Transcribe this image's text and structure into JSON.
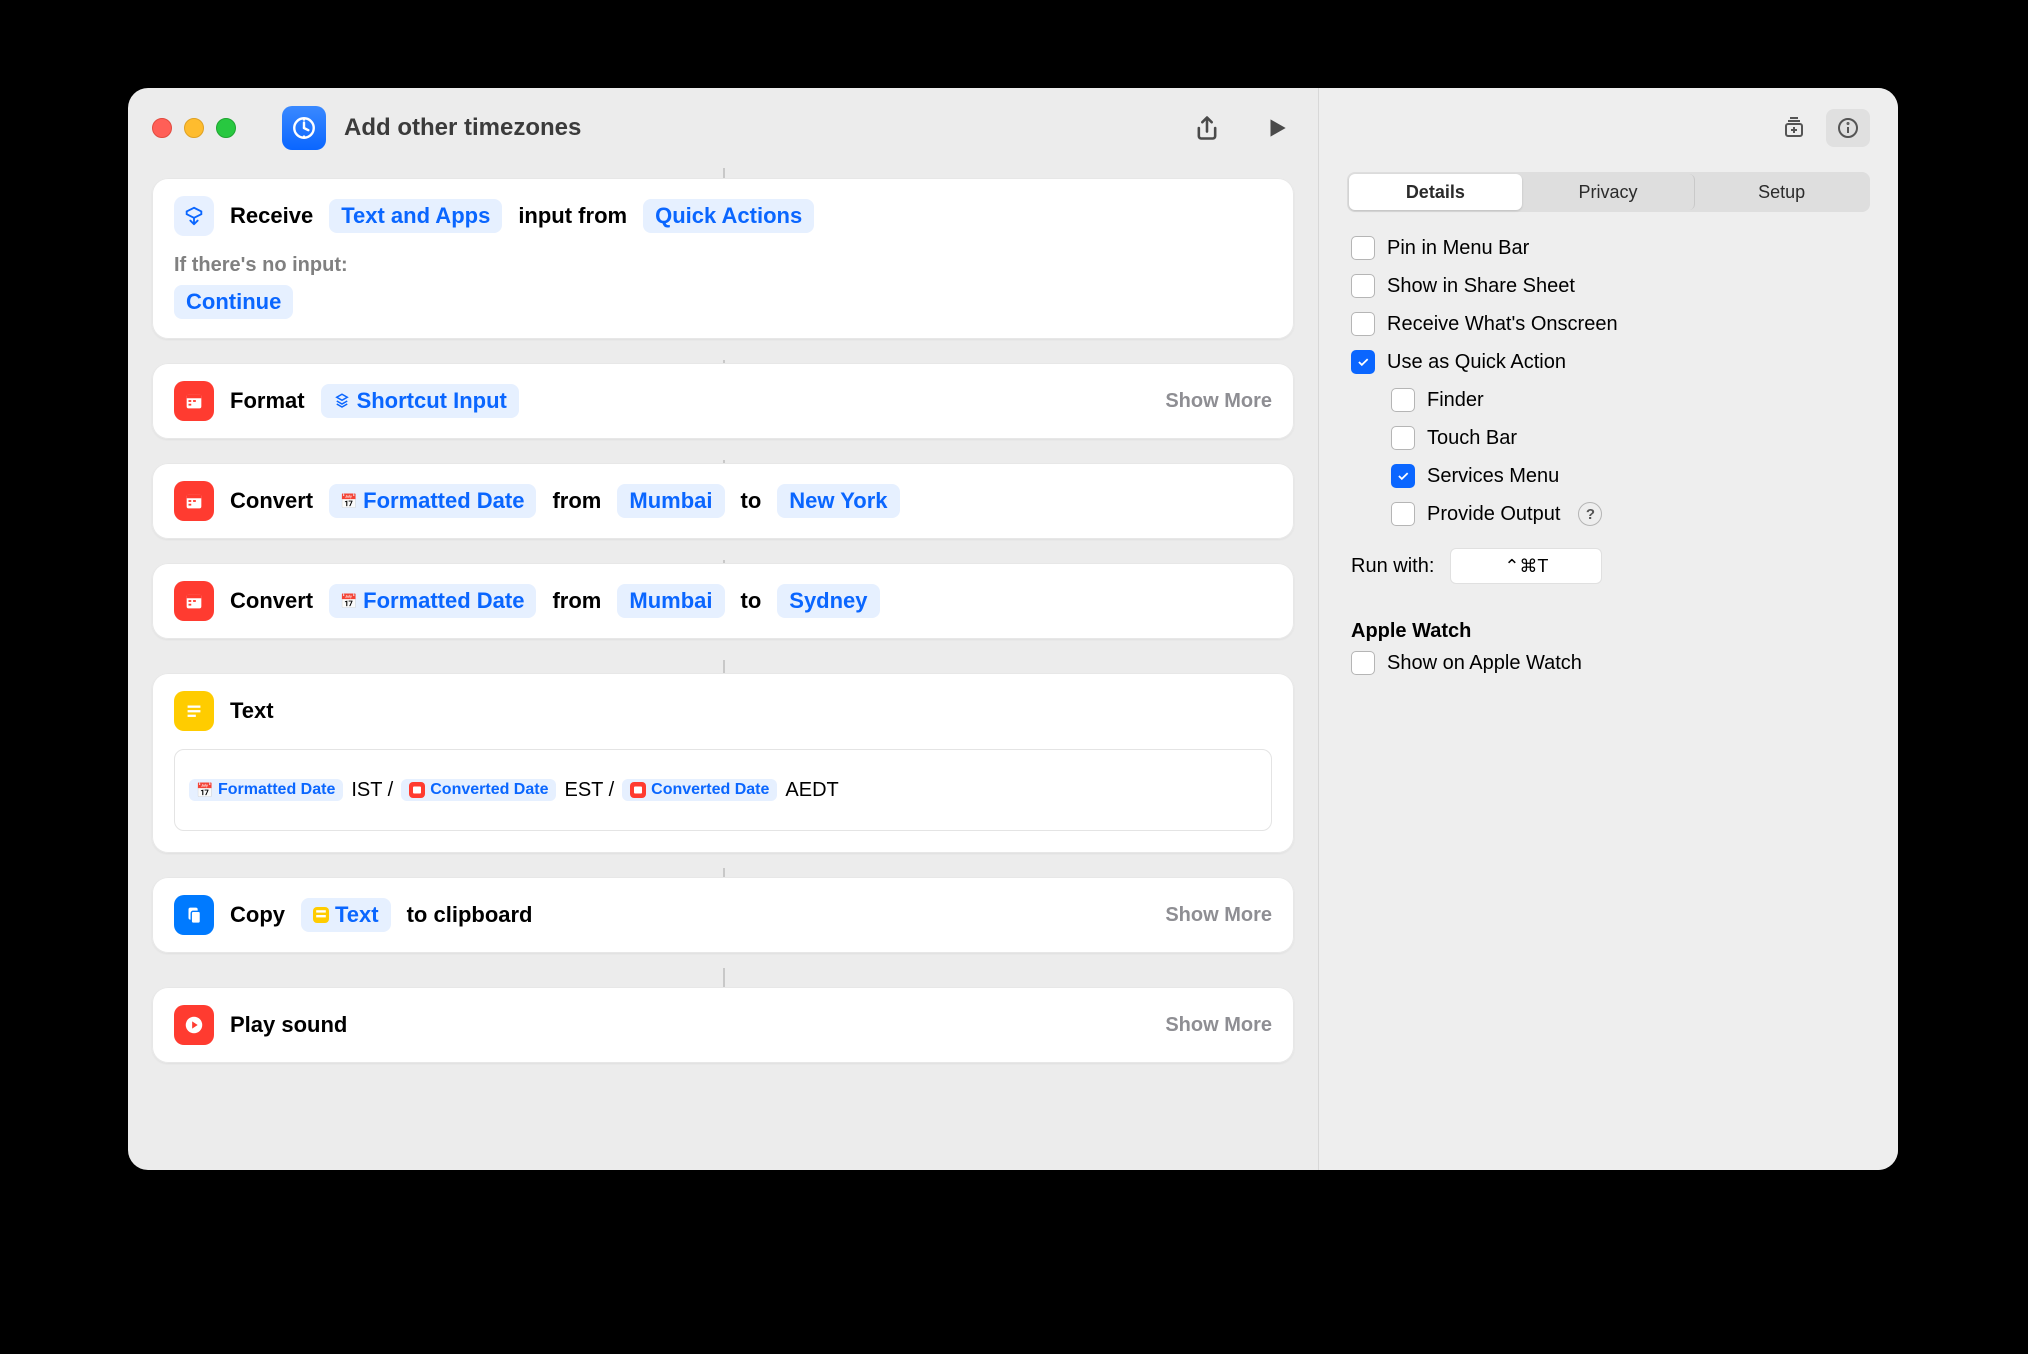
{
  "header": {
    "title": "Add other timezones"
  },
  "actions": {
    "receive": {
      "verb": "Receive",
      "token_types": "Text and Apps",
      "mid": "input from",
      "token_source": "Quick Actions",
      "noinput_label": "If there's no input:",
      "noinput_value": "Continue"
    },
    "format": {
      "verb": "Format",
      "token": "Shortcut Input",
      "show_more": "Show More"
    },
    "convert1": {
      "verb": "Convert",
      "token": "Formatted Date",
      "from": "from",
      "city_from": "Mumbai",
      "to": "to",
      "city_to": "New York"
    },
    "convert2": {
      "verb": "Convert",
      "token": "Formatted Date",
      "from": "from",
      "city_from": "Mumbai",
      "to": "to",
      "city_to": "Sydney"
    },
    "text": {
      "verb": "Text",
      "tok1": "Formatted Date",
      "t1": "IST /",
      "tok2": "Converted Date",
      "t2": "EST /",
      "tok3": "Converted Date",
      "t3": "AEDT"
    },
    "copy": {
      "verb": "Copy",
      "token": "Text",
      "suffix": "to clipboard",
      "show_more": "Show More"
    },
    "play": {
      "verb": "Play sound",
      "show_more": "Show More"
    }
  },
  "inspector": {
    "tabs": {
      "details": "Details",
      "privacy": "Privacy",
      "setup": "Setup"
    },
    "opts": {
      "pin_menubar": "Pin in Menu Bar",
      "share_sheet": "Show in Share Sheet",
      "receive_onscreen": "Receive What's Onscreen",
      "quick_action": "Use as Quick Action",
      "finder": "Finder",
      "touchbar": "Touch Bar",
      "services": "Services Menu",
      "provide_output": "Provide Output"
    },
    "run_with_label": "Run with:",
    "run_with_hotkey": "⌃⌘T",
    "watch_section": "Apple Watch",
    "watch_opt": "Show on Apple Watch"
  }
}
